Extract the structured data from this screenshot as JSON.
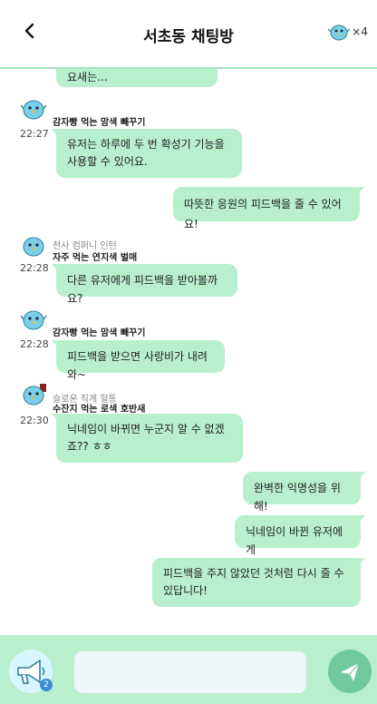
{
  "header": {
    "back_icon": "chevron-left-icon",
    "title": "서초동 채팅방",
    "member_count": "×4"
  },
  "messages": [
    {
      "side": "left",
      "text": "요새는..."
    },
    {
      "side": "left",
      "sender": "감자빵 먹는 맘색 빼꾸기",
      "time": "22:27",
      "text": "유저는 하루에 두 번 확성기 기능을 사용할 수 있어요."
    },
    {
      "side": "right",
      "text": "따뜻한 응원의 피드백을 줄 수 있어요!"
    },
    {
      "side": "left",
      "title": "천사 컴퍼니 인턴",
      "sender": "자주 먹는 연지색 벌매",
      "time": "22:28",
      "text": "다른 유저에게 피드백을 받아볼까요?"
    },
    {
      "side": "left",
      "sender": "감자빵 먹는 맘색 빼꾸기",
      "time": "22:28",
      "text": "피드백을 받으면 사랑비가 내려와~"
    },
    {
      "side": "left",
      "title": "슬로운 직계 혈통",
      "sender": "수잔지 먹는 로색 호반새",
      "time": "22:30",
      "text": "닉네임이 바뀌면 누군지 알 수 없겠죠?? ㅎㅎ"
    },
    {
      "side": "right",
      "text": "완벽한 익명성을 위해!"
    },
    {
      "side": "right",
      "text": "닉네임이 바뀐 유저에게"
    },
    {
      "side": "right",
      "text": "피드백을 주지 않았던 것처럼 다시 줄 수 있답니다!"
    }
  ],
  "footer": {
    "megaphone_badge": "2",
    "input_placeholder": "",
    "send_icon": "send-icon"
  },
  "colors": {
    "bubble": "#b8efcd",
    "accent": "#9fe3bf",
    "send": "#6fc99a"
  }
}
